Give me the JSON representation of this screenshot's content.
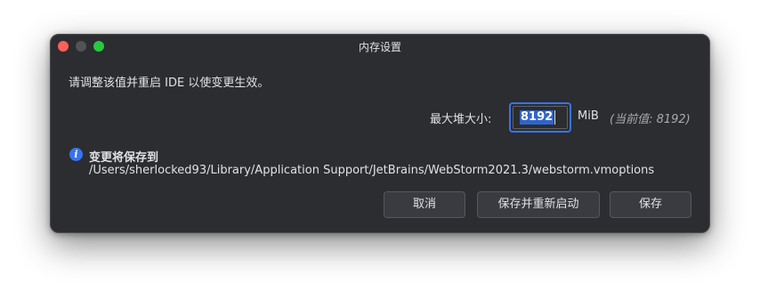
{
  "window": {
    "title": "内存设置",
    "controls": [
      "close",
      "minimize",
      "maximize"
    ]
  },
  "message": "请调整该值并重启 IDE 以使变更生效。",
  "heap": {
    "label": "最大堆大小:",
    "value": "8192",
    "unit": "MiB",
    "current": "(当前值: 8192)"
  },
  "info": {
    "icon": "info-icon",
    "title": "变更将保存到",
    "path": "/Users/sherlocked93/Library/Application Support/JetBrains/WebStorm2021.3/webstorm.vmoptions"
  },
  "buttons": {
    "cancel": "取消",
    "save_restart": "保存并重新启动",
    "save": "保存"
  },
  "colors": {
    "background": "#2b2d30",
    "accent": "#3574f0",
    "text": "#dfe1e5",
    "close": "#ff5f57",
    "minimize": "#515356",
    "maximize": "#28c840"
  }
}
